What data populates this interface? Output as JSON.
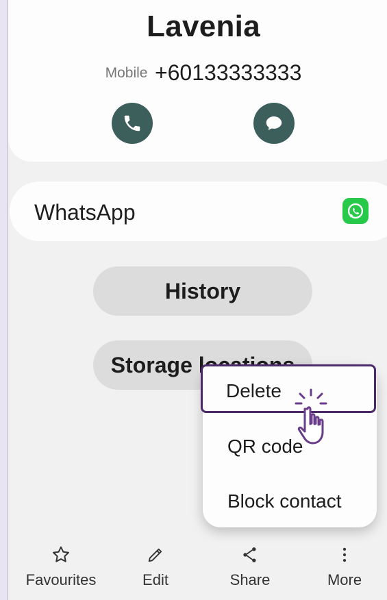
{
  "contact": {
    "name": "Lavenia",
    "phone_type": "Mobile",
    "phone_number": "+60133333333"
  },
  "apps": {
    "whatsapp_label": "WhatsApp"
  },
  "buttons": {
    "history": "History",
    "storage_locations": "Storage locations"
  },
  "menu": {
    "items": [
      "Delete",
      "QR code",
      "Block contact"
    ],
    "highlighted": "Delete"
  },
  "bottom_nav": {
    "items": [
      {
        "label": "Favourites",
        "icon": "star-icon"
      },
      {
        "label": "Edit",
        "icon": "pencil-icon"
      },
      {
        "label": "Share",
        "icon": "share-icon"
      },
      {
        "label": "More",
        "icon": "more-vertical-icon"
      }
    ]
  },
  "colors": {
    "action_button": "#3c5f5b",
    "whatsapp": "#27c94b",
    "highlight_border": "#4c2a6a"
  }
}
